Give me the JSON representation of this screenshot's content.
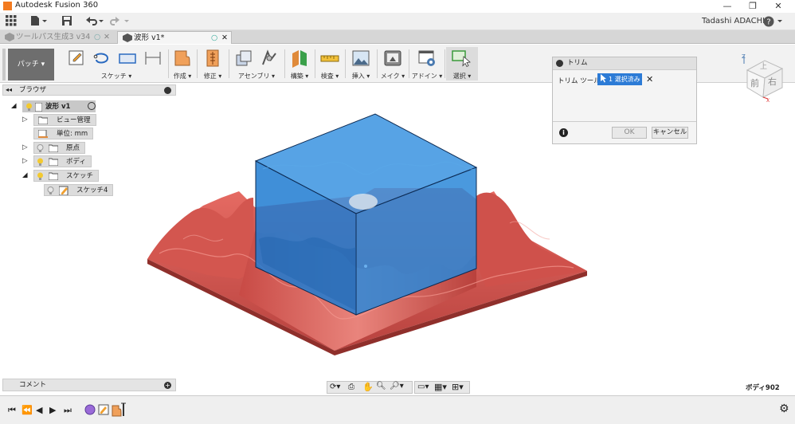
{
  "app": {
    "title": "Autodesk Fusion 360",
    "user": "Tadashi ADACHI"
  },
  "window": {
    "minimize": "—",
    "restore": "❐",
    "close": "✕"
  },
  "tabs": [
    {
      "label": "ツールパス生成3 v34",
      "active": false
    },
    {
      "label": "波形 v1*",
      "active": true
    }
  ],
  "toolbar": {
    "workspace": "パッチ",
    "groups": [
      {
        "label": "スケッチ ▾"
      },
      {
        "label": "作成 ▾"
      },
      {
        "label": "修正 ▾"
      },
      {
        "label": "アセンブリ ▾"
      },
      {
        "label": "構築 ▾"
      },
      {
        "label": "検査 ▾"
      },
      {
        "label": "挿入 ▾"
      },
      {
        "label": "メイク ▾"
      },
      {
        "label": "アドイン ▾"
      },
      {
        "label": "選択 ▾"
      }
    ]
  },
  "browser": {
    "title": "ブラウザ",
    "root": "波形 v1",
    "items": [
      "ビュー管理",
      "単位: mm",
      "原点",
      "ボディ",
      "スケッチ",
      "スケッチ4"
    ]
  },
  "dialog": {
    "title": "トリム",
    "field_label": "トリム ツール",
    "selection": "1 選択済み",
    "ok": "OK",
    "cancel": "キャンセル"
  },
  "comment": {
    "label": "コメント"
  },
  "status": {
    "body": "ボディ902"
  },
  "viewcube": {
    "front": "前",
    "right": "右",
    "top": "上"
  },
  "colors": {
    "box": "#1d7fd4",
    "surface": "#d9605a",
    "accent": "#2c7bd6"
  }
}
